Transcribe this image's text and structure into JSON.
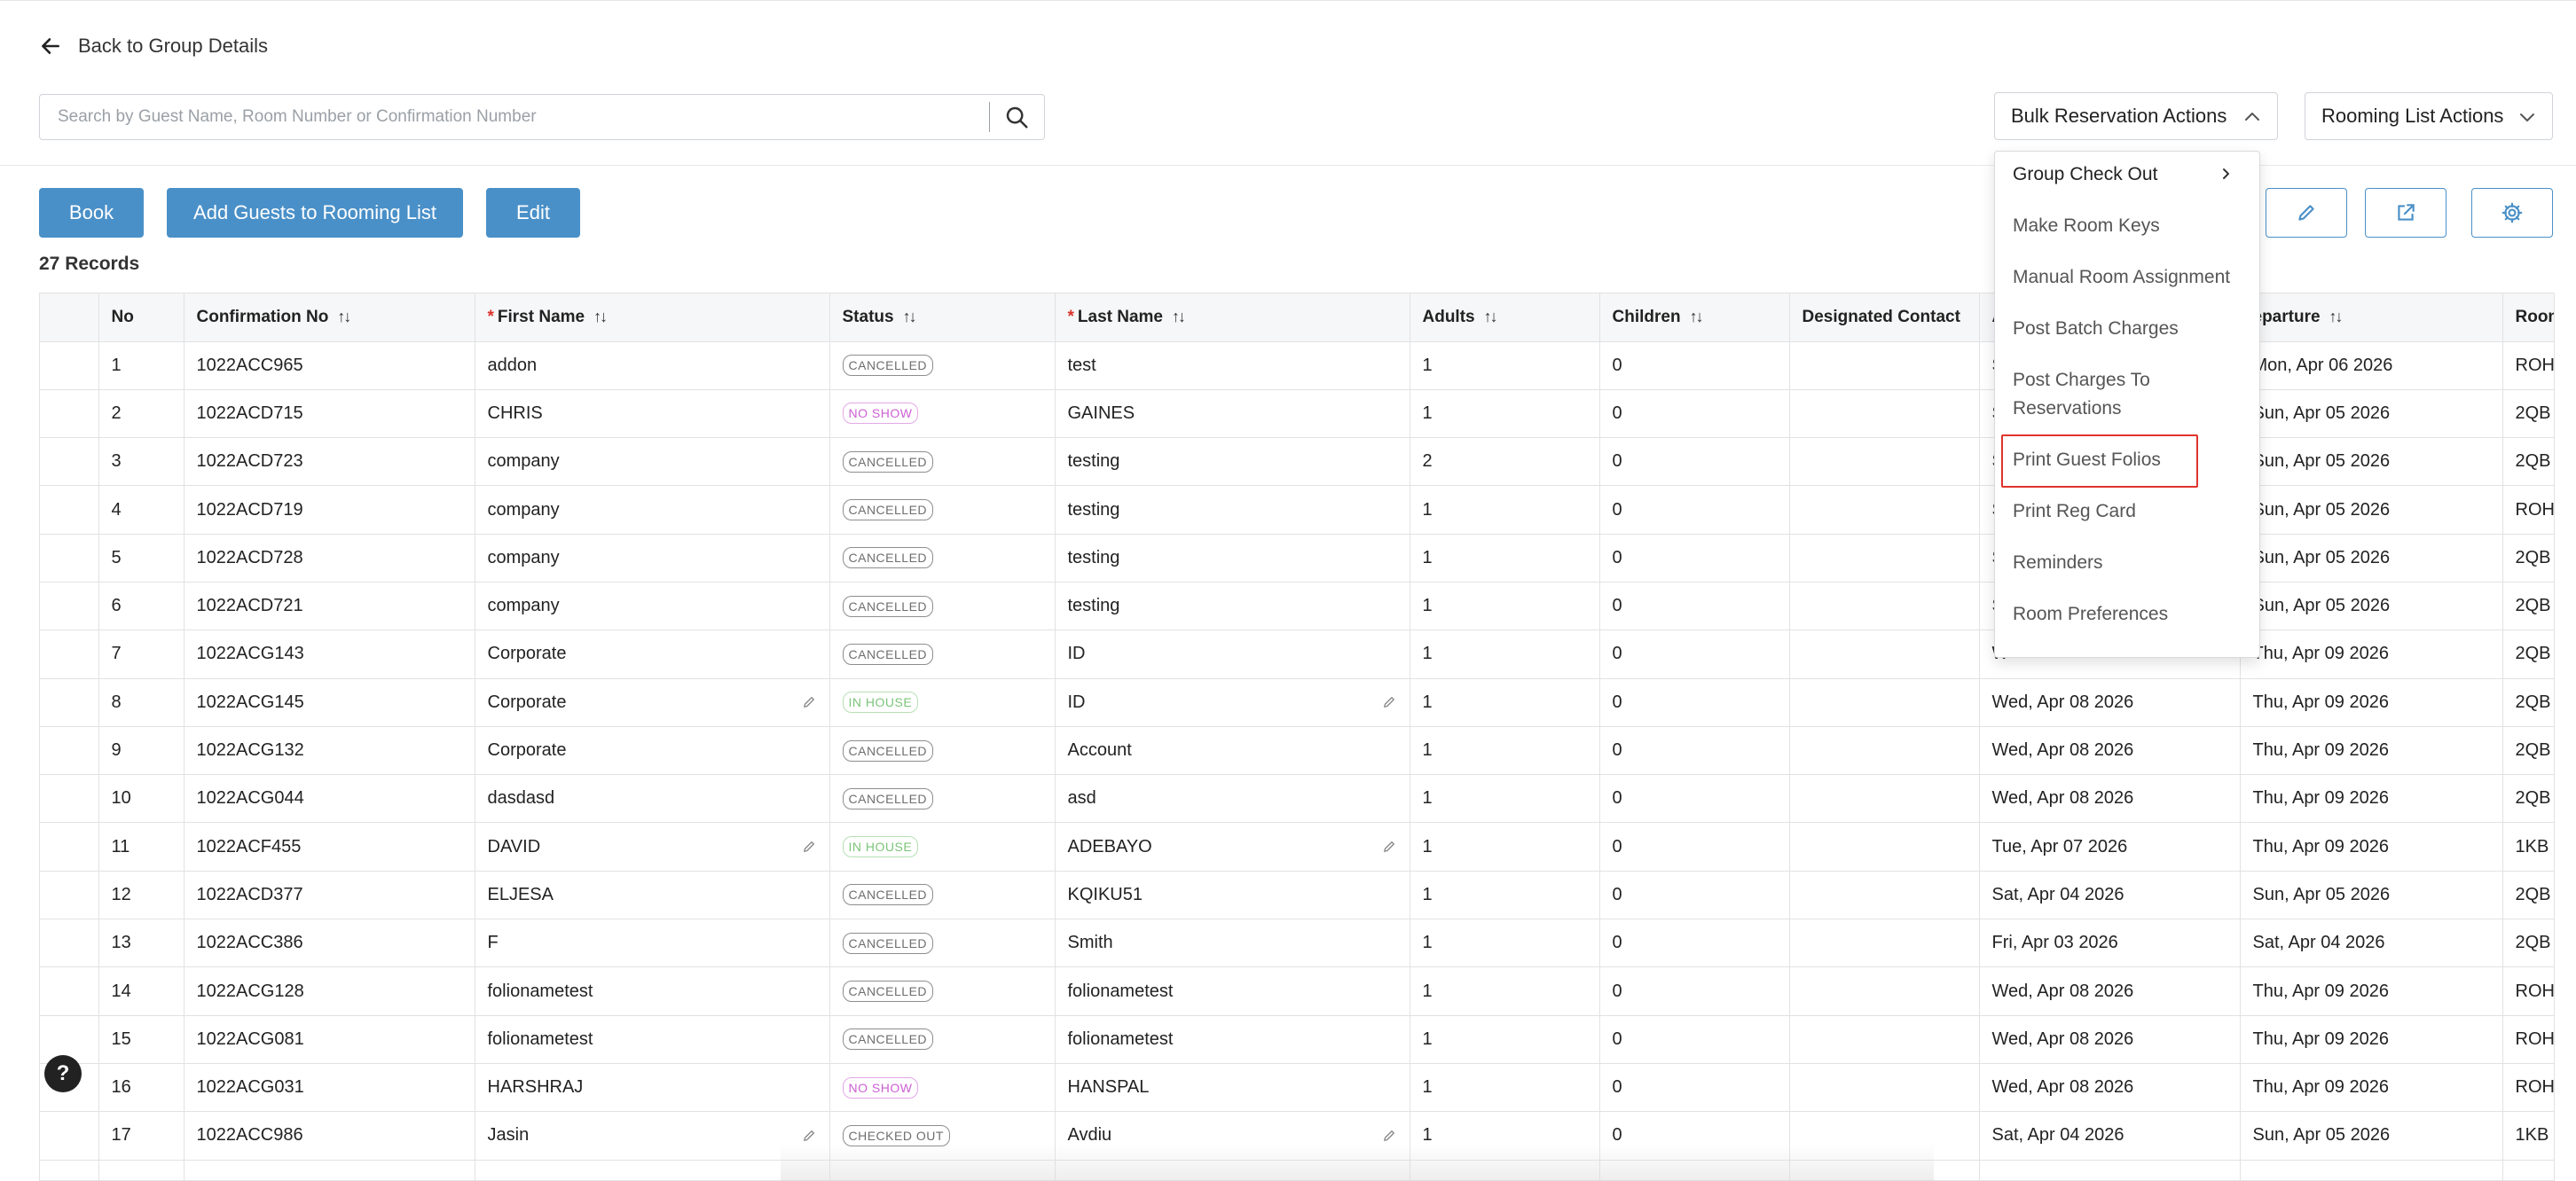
{
  "nav": {
    "back_label": "Back to Group Details"
  },
  "search": {
    "placeholder": "Search by Guest Name, Room Number or Confirmation Number"
  },
  "actions": {
    "bulk_label": "Bulk Reservation Actions",
    "rooming_label": "Rooming List Actions",
    "book_label": "Book",
    "add_guests_label": "Add Guests to Rooming List",
    "edit_label": "Edit"
  },
  "records": "27 Records",
  "menu": {
    "items": [
      "Group Check Out",
      "Make Room Keys",
      "Manual Room Assignment",
      "Post Batch Charges",
      "Post Charges To",
      "Reservations",
      "Print Guest Folios",
      "Print Reg Card",
      "Reminders",
      "Room Preferences"
    ],
    "highlighted": "Print Guest Folios"
  },
  "table": {
    "headers": {
      "no": "No",
      "confirmation": "Confirmation No",
      "first_name": "First Name",
      "status": "Status",
      "last_name": "Last Name",
      "adults": "Adults",
      "children": "Children",
      "designated": "Designated Contact",
      "arrival": "A",
      "departure": "eparture",
      "room": "Room"
    },
    "required_mark": "*",
    "sort_glyph": "↑↓",
    "rows": [
      {
        "no": "1",
        "conf": "1022ACC965",
        "first": "addon",
        "status": "CANCELLED",
        "last": "test",
        "adults": "1",
        "children": "0",
        "arrival": "S",
        "departure": "Mon, Apr 06 2026",
        "room": "ROH"
      },
      {
        "no": "2",
        "conf": "1022ACD715",
        "first": "CHRIS",
        "status": "NO SHOW",
        "last": "GAINES",
        "adults": "1",
        "children": "0",
        "arrival": "S",
        "departure": "Sun, Apr 05 2026",
        "room": "2QB"
      },
      {
        "no": "3",
        "conf": "1022ACD723",
        "first": "company",
        "status": "CANCELLED",
        "last": "testing",
        "adults": "2",
        "children": "0",
        "arrival": "S",
        "departure": "Sun, Apr 05 2026",
        "room": "2QB"
      },
      {
        "no": "4",
        "conf": "1022ACD719",
        "first": "company",
        "status": "CANCELLED",
        "last": "testing",
        "adults": "1",
        "children": "0",
        "arrival": "S",
        "departure": "Sun, Apr 05 2026",
        "room": "ROH"
      },
      {
        "no": "5",
        "conf": "1022ACD728",
        "first": "company",
        "status": "CANCELLED",
        "last": "testing",
        "adults": "1",
        "children": "0",
        "arrival": "S",
        "departure": "Sun, Apr 05 2026",
        "room": "2QB"
      },
      {
        "no": "6",
        "conf": "1022ACD721",
        "first": "company",
        "status": "CANCELLED",
        "last": "testing",
        "adults": "1",
        "children": "0",
        "arrival": "S",
        "departure": "Sun, Apr 05 2026",
        "room": "2QB"
      },
      {
        "no": "7",
        "conf": "1022ACG143",
        "first": "Corporate",
        "status": "CANCELLED",
        "last": "ID",
        "adults": "1",
        "children": "0",
        "arrival": "W",
        "departure": "Thu, Apr 09 2026",
        "room": "2QB"
      },
      {
        "no": "8",
        "conf": "1022ACG145",
        "first": "Corporate",
        "status": "IN HOUSE",
        "last": "ID",
        "adults": "1",
        "children": "0",
        "arrival": "Wed, Apr 08 2026",
        "departure": "Thu, Apr 09 2026",
        "room": "2QB",
        "editable": true
      },
      {
        "no": "9",
        "conf": "1022ACG132",
        "first": "Corporate",
        "status": "CANCELLED",
        "last": "Account",
        "adults": "1",
        "children": "0",
        "arrival": "Wed, Apr 08 2026",
        "departure": "Thu, Apr 09 2026",
        "room": "2QB"
      },
      {
        "no": "10",
        "conf": "1022ACG044",
        "first": "dasdasd",
        "status": "CANCELLED",
        "last": "asd",
        "adults": "1",
        "children": "0",
        "arrival": "Wed, Apr 08 2026",
        "departure": "Thu, Apr 09 2026",
        "room": "2QB"
      },
      {
        "no": "11",
        "conf": "1022ACF455",
        "first": "DAVID",
        "status": "IN HOUSE",
        "last": "ADEBAYO",
        "adults": "1",
        "children": "0",
        "arrival": "Tue, Apr 07 2026",
        "departure": "Thu, Apr 09 2026",
        "room": "1KB",
        "editable": true
      },
      {
        "no": "12",
        "conf": "1022ACD377",
        "first": "ELJESA",
        "status": "CANCELLED",
        "last": "KQIKU51",
        "adults": "1",
        "children": "0",
        "arrival": "Sat, Apr 04 2026",
        "departure": "Sun, Apr 05 2026",
        "room": "2QB"
      },
      {
        "no": "13",
        "conf": "1022ACC386",
        "first": "F",
        "status": "CANCELLED",
        "last": "Smith",
        "adults": "1",
        "children": "0",
        "arrival": "Fri, Apr 03 2026",
        "departure": "Sat, Apr 04 2026",
        "room": "2QB"
      },
      {
        "no": "14",
        "conf": "1022ACG128",
        "first": "folionametest",
        "status": "CANCELLED",
        "last": "folionametest",
        "adults": "1",
        "children": "0",
        "arrival": "Wed, Apr 08 2026",
        "departure": "Thu, Apr 09 2026",
        "room": "ROH"
      },
      {
        "no": "15",
        "conf": "1022ACG081",
        "first": "folionametest",
        "status": "CANCELLED",
        "last": "folionametest",
        "adults": "1",
        "children": "0",
        "arrival": "Wed, Apr 08 2026",
        "departure": "Thu, Apr 09 2026",
        "room": "ROH"
      },
      {
        "no": "16",
        "conf": "1022ACG031",
        "first": "HARSHRAJ",
        "status": "NO SHOW",
        "last": "HANSPAL",
        "adults": "1",
        "children": "0",
        "arrival": "Wed, Apr 08 2026",
        "departure": "Thu, Apr 09 2026",
        "room": "ROH"
      },
      {
        "no": "17",
        "conf": "1022ACC986",
        "first": "Jasin",
        "status": "CHECKED OUT",
        "last": "Avdiu",
        "adults": "1",
        "children": "0",
        "arrival": "Sat, Apr 04 2026",
        "departure": "Sun, Apr 05 2026",
        "room": "1KB",
        "editable": true
      }
    ]
  },
  "help": {
    "label": "?"
  },
  "colors": {
    "primary": "#4a90c8",
    "highlight": "#e0332d",
    "required": "#d9342b"
  }
}
